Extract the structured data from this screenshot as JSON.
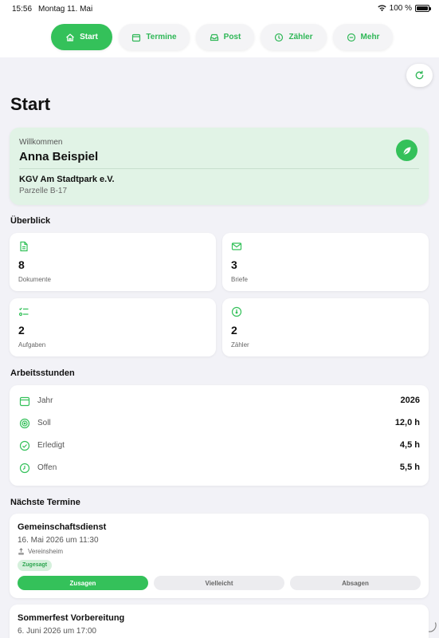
{
  "status": {
    "time": "15:56",
    "date": "Montag 11. Mai",
    "battery": "100 %"
  },
  "tabs": [
    {
      "label": "Start",
      "icon": "home-icon",
      "active": true
    },
    {
      "label": "Termine",
      "icon": "calendar-icon",
      "active": false
    },
    {
      "label": "Post",
      "icon": "inbox-icon",
      "active": false
    },
    {
      "label": "Zähler",
      "icon": "meter-icon",
      "active": false
    },
    {
      "label": "Mehr",
      "icon": "more-icon",
      "active": false
    }
  ],
  "page": {
    "title": "Start"
  },
  "welcome": {
    "label": "Willkommen",
    "name": "Anna Beispiel",
    "club": "KGV Am Stadtpark e.V.",
    "plot": "Parzelle B-17",
    "icon": "leaf-icon"
  },
  "overview": {
    "title": "Überblick",
    "cards": [
      {
        "value": "8",
        "label": "Dokumente",
        "icon": "document-icon"
      },
      {
        "value": "3",
        "label": "Briefe",
        "icon": "envelope-icon"
      },
      {
        "value": "2",
        "label": "Aufgaben",
        "icon": "task-list-icon"
      },
      {
        "value": "2",
        "label": "Zähler",
        "icon": "meter-icon"
      }
    ]
  },
  "work_hours": {
    "title": "Arbeitsstunden",
    "rows": [
      {
        "label": "Jahr",
        "value": "2026",
        "icon": "calendar-icon"
      },
      {
        "label": "Soll",
        "value": "12,0 h",
        "icon": "target-icon"
      },
      {
        "label": "Erledigt",
        "value": "4,5 h",
        "icon": "check-circle-icon"
      },
      {
        "label": "Offen",
        "value": "5,5 h",
        "icon": "clock-icon"
      }
    ]
  },
  "events": {
    "title": "Nächste Termine",
    "items": [
      {
        "title": "Gemeinschaftsdienst",
        "when": "16. Mai 2026 um 11:30",
        "location": "Vereinsheim",
        "badge": "Zugesagt",
        "actions": [
          "Zusagen",
          "Vielleicht",
          "Absagen"
        ]
      },
      {
        "title": "Sommerfest Vorbereitung",
        "when": "6. Juni 2026 um 17:00"
      }
    ]
  },
  "colors": {
    "accent": "#34c15a",
    "background": "#f2f2f7",
    "welcome_bg": "#e1f3e6"
  }
}
